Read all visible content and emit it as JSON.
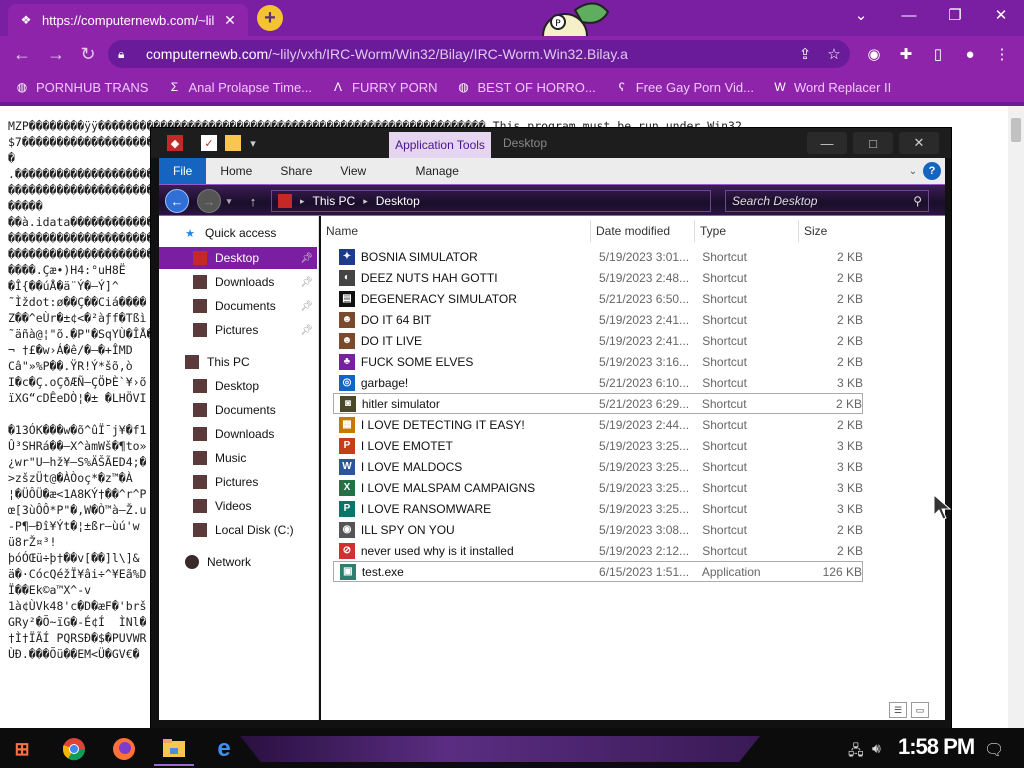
{
  "browser": {
    "tab_title": "https://computernewb.com/~lil",
    "url_host": "computernewb.com",
    "url_path": "/~lily/vxh/IRC-Worm/Win32/Bilay/IRC-Worm.Win32.Bilay.a",
    "bookmarks": [
      {
        "label": "PORNHUB TRANS"
      },
      {
        "label": "Anal Prolapse Time..."
      },
      {
        "label": "FURRY PORN"
      },
      {
        "label": "BEST OF HORRO..."
      },
      {
        "label": "Free Gay Porn Vid..."
      },
      {
        "label": "Word Replacer II"
      }
    ]
  },
  "page": {
    "binary_text": "MZP��������ÿÿ�������������������������������������������������������� This program must be run under Win32\n$7���������������������������������������������������������������������������à���\n�\n.����������������������������������������������������������������������������������������`�\n�����������������������������������������������������������������������������\n�����\n��à.idata����������������������������������������������������������������\n��������������������������������������������������������������������������������\n��������������������������������������������������������������������������������\n����.Çæ•)H4:°uH8Ë\n�Î{��úÅ�ä¨Ý�–Ý]^\n˜Ìždot:ø��Ç��Ciá����\nZ��^eÙr�±¢<�²àƒf�Tßì\n˜äñà@¦\"õ.�P\"�SqYÙ�ÎÅ�\n¬ †£�w›Á�ê/�–�+ÎMD\nCâ\"»%P��.ŸR!Ý*šõ,ò\nI�c�Ç.oÇðÆÑ–ÇÖÞÈ`¥›õ\nïXG“cDÊeDÒ¦�± �LHÖVI\n\n�13ÓK���w�õ^ûÏ¯j¥�f1                                                                                    •j²9h-\nÛ³SHRá��–X^àmWš�¶to»\n¿wr\"U–hž¥–S%ÄŠÃED4;�\n>zšzÜt@�ÀÒoç*�z™�À\n¦�ÜÔÜ�æ<1A8KÝ†��^r^P\nœ[3ùÔÔ*P\"�,W�Ò™à–Ž.u\n-P¶–Ðî¥Ýt�¦±ßr–ùú'w\nü8rŽ¤³!\nþóÓŒü÷þ†��v[��]l\\]&\nä�·CócQéžÏ¥âi÷^¥Eã%D\nÏ��Ek©a™X^-v\n1à¢ÙVk48'c�D�æF�'brš\nGRy²�Õ~ïG�-É¢Í  ÌNl�\n†Ì†ÏÃÍ PQRSÐ�$�PUVWR\nÙÐ.���Õü��EM<Ü�GV€�"
  },
  "explorer": {
    "quick_icons": [
      "app-icon",
      "properties-icon",
      "folder-icon",
      "dropdown-icon"
    ],
    "app_tools": "Application Tools",
    "title": "Desktop",
    "tabs": {
      "file": "File",
      "home": "Home",
      "share": "Share",
      "view": "View",
      "manage": "Manage"
    },
    "breadcrumb": [
      "This PC",
      "Desktop"
    ],
    "search_placeholder": "Search Desktop",
    "nav": {
      "quick_access": "Quick access",
      "quick_items": [
        {
          "label": "Desktop",
          "selected": true,
          "pinned": true
        },
        {
          "label": "Downloads",
          "pinned": true
        },
        {
          "label": "Documents",
          "pinned": true
        },
        {
          "label": "Pictures",
          "pinned": true
        }
      ],
      "this_pc": "This PC",
      "pc_items": [
        {
          "label": "Desktop"
        },
        {
          "label": "Documents"
        },
        {
          "label": "Downloads"
        },
        {
          "label": "Music"
        },
        {
          "label": "Pictures"
        },
        {
          "label": "Videos"
        },
        {
          "label": "Local Disk (C:)"
        }
      ],
      "network": "Network"
    },
    "columns": {
      "name": "Name",
      "date": "Date modified",
      "type": "Type",
      "size": "Size"
    },
    "files": [
      {
        "name": "BOSNIA SIMULATOR",
        "date": "5/19/2023 3:01...",
        "type": "Shortcut",
        "size": "2 KB",
        "icon": "bosnia-icon",
        "color": "#1e3a8a"
      },
      {
        "name": "DEEZ NUTS HAH GOTTI",
        "date": "5/19/2023 2:48...",
        "type": "Shortcut",
        "size": "2 KB",
        "icon": "deez-icon",
        "color": "#444444"
      },
      {
        "name": "DEGENERACY SIMULATOR",
        "date": "5/21/2023 6:50...",
        "type": "Shortcut",
        "size": "2 KB",
        "icon": "terminal-icon",
        "color": "#111111"
      },
      {
        "name": "DO IT 64 BIT",
        "date": "5/19/2023 2:41...",
        "type": "Shortcut",
        "size": "2 KB",
        "icon": "face-icon",
        "color": "#7a4a2a"
      },
      {
        "name": "DO IT LIVE",
        "date": "5/19/2023 2:41...",
        "type": "Shortcut",
        "size": "2 KB",
        "icon": "face-icon",
        "color": "#7a4a2a"
      },
      {
        "name": "FUCK SOME ELVES",
        "date": "5/19/2023 3:16...",
        "type": "Shortcut",
        "size": "2 KB",
        "icon": "elves-icon",
        "color": "#7b1fa2"
      },
      {
        "name": "garbage!",
        "date": "5/21/2023 6:10...",
        "type": "Shortcut",
        "size": "3 KB",
        "icon": "garbage-icon",
        "color": "#1565c0"
      },
      {
        "name": "hitler simulator",
        "date": "5/21/2023 6:29...",
        "type": "Shortcut",
        "size": "2 KB",
        "icon": "sim-icon",
        "color": "#4a4a2a"
      },
      {
        "name": "I LOVE DETECTING IT EASY!",
        "date": "5/19/2023 2:44...",
        "type": "Shortcut",
        "size": "2 KB",
        "icon": "die-icon",
        "color": "#c47a00"
      },
      {
        "name": "I LOVE EMOTET",
        "date": "5/19/2023 3:25...",
        "type": "Shortcut",
        "size": "3 KB",
        "icon": "powerpoint-icon",
        "color": "#c43e1c"
      },
      {
        "name": "I LOVE MALDOCS",
        "date": "5/19/2023 3:25...",
        "type": "Shortcut",
        "size": "3 KB",
        "icon": "word-icon",
        "color": "#2b579a"
      },
      {
        "name": "I LOVE MALSPAM CAMPAIGNS",
        "date": "5/19/2023 3:25...",
        "type": "Shortcut",
        "size": "3 KB",
        "icon": "excel-icon",
        "color": "#217346"
      },
      {
        "name": "I LOVE RANSOMWARE",
        "date": "5/19/2023 3:25...",
        "type": "Shortcut",
        "size": "3 KB",
        "icon": "publisher-icon",
        "color": "#077568"
      },
      {
        "name": "ILL SPY ON YOU",
        "date": "5/19/2023 3:08...",
        "type": "Shortcut",
        "size": "2 KB",
        "icon": "spy-icon",
        "color": "#555555"
      },
      {
        "name": "never used why is it installed",
        "date": "5/19/2023 2:12...",
        "type": "Shortcut",
        "size": "2 KB",
        "icon": "no-icon",
        "color": "#d32f2f"
      },
      {
        "name": "test.exe",
        "date": "6/15/2023 1:51...",
        "type": "Application",
        "size": "126 KB",
        "icon": "exe-icon",
        "color": "#2e7d6e"
      }
    ]
  },
  "taskbar": {
    "clock": "1:58 PM",
    "apps": [
      "start-icon",
      "chrome-icon",
      "firefox-icon",
      "file-explorer-icon",
      "edge-icon"
    ]
  }
}
